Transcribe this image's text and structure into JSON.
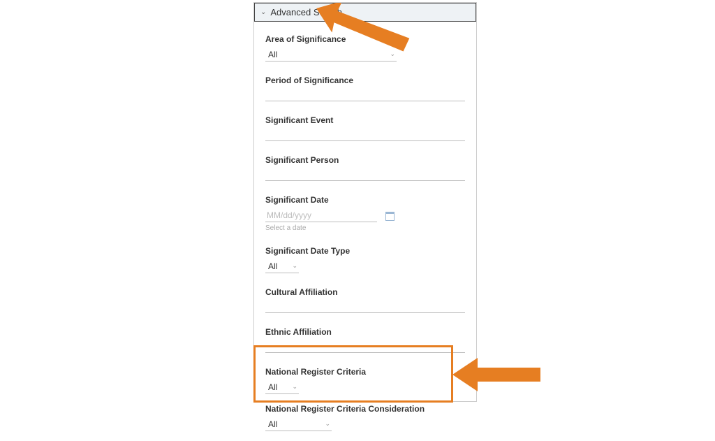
{
  "header": {
    "title": "Advanced Search"
  },
  "fields": {
    "area_of_significance": {
      "label": "Area of Significance",
      "value": "All"
    },
    "period_of_significance": {
      "label": "Period of Significance"
    },
    "significant_event": {
      "label": "Significant Event"
    },
    "significant_person": {
      "label": "Significant Person"
    },
    "significant_date": {
      "label": "Significant Date",
      "placeholder": "MM/dd/yyyy",
      "helper": "Select a date"
    },
    "significant_date_type": {
      "label": "Significant Date Type",
      "value": "All"
    },
    "cultural_affiliation": {
      "label": "Cultural Affiliation"
    },
    "ethnic_affiliation": {
      "label": "Ethnic Affiliation"
    },
    "national_register_criteria": {
      "label": "National Register Criteria",
      "value": "All"
    },
    "national_register_criteria_consideration": {
      "label": "National Register Criteria Consideration",
      "value": "All"
    }
  },
  "annotations": {
    "arrow_color": "#e67e22"
  }
}
